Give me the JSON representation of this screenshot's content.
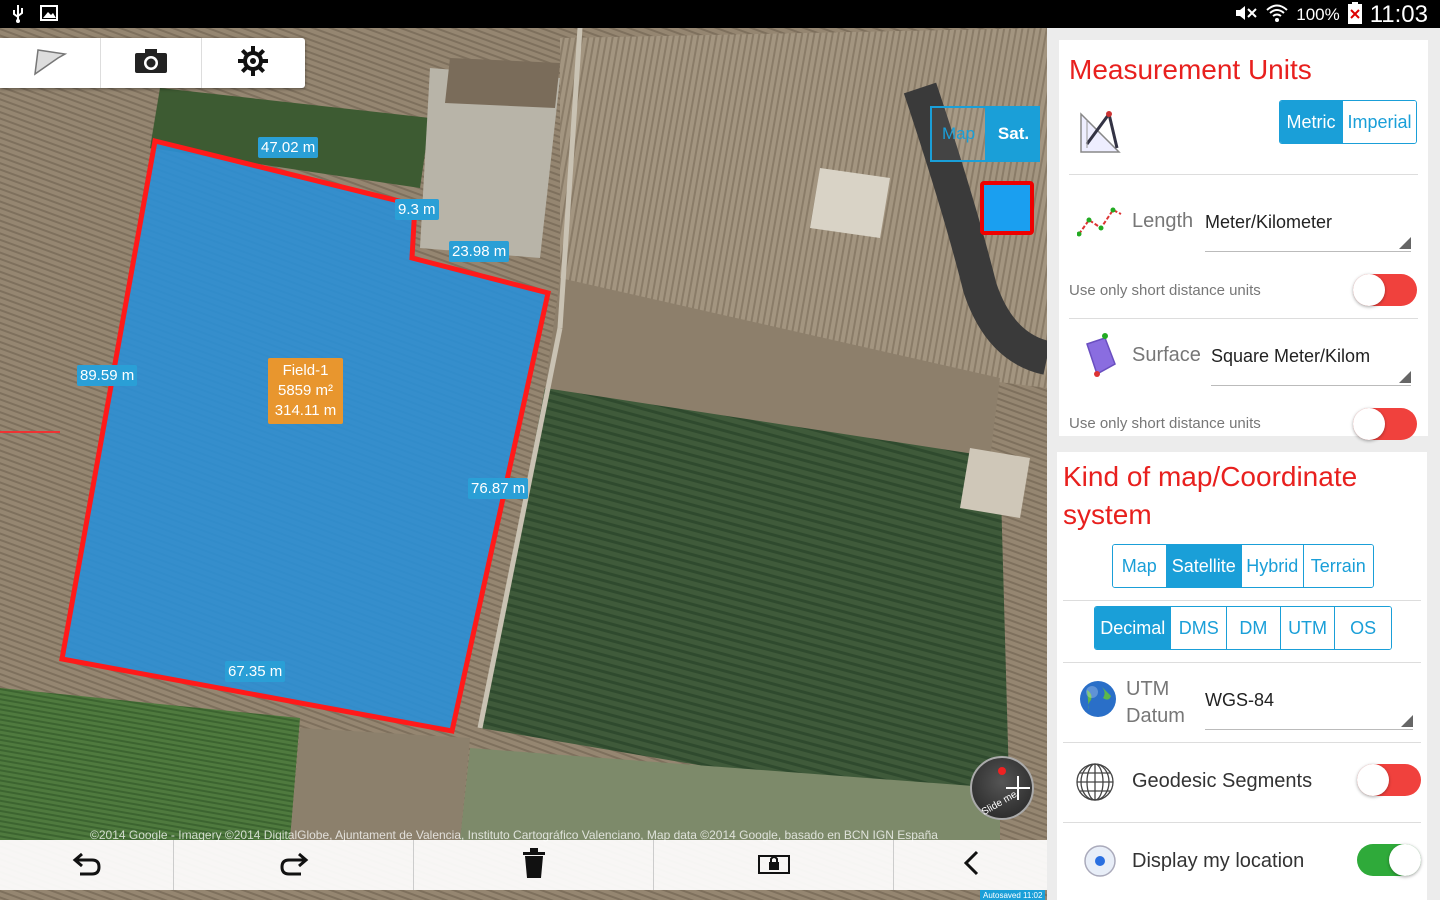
{
  "statusbar": {
    "battery": "100%",
    "time": "11:03"
  },
  "toolbar": {
    "icons": [
      "polygon-icon",
      "camera-icon",
      "gear-icon"
    ]
  },
  "map_toggle": {
    "map_label": "Map",
    "sat_label": "Sat."
  },
  "field": {
    "name": "Field-1",
    "area": "5859 m²",
    "perimeter": "314.11 m",
    "segments": [
      "47.02 m",
      "9.3 m",
      "23.98 m",
      "89.59 m",
      "76.87 m",
      "67.35 m"
    ]
  },
  "copyright": "©2014 Google - Imagery ©2014 DigitalGlobe, Ajuntament de Valencia, Instituto Cartográfico Valenciano, Map data ©2014 Google, basado en BCN IGN España",
  "autosaved": "Autosaved 11:02",
  "compass_label": "Slide me",
  "measurement": {
    "title": "Measurement Units",
    "systems": [
      "Metric",
      "Imperial"
    ],
    "selected_system": "Metric",
    "length_label": "Length",
    "length_value": "Meter/Kilometer",
    "length_short_text": "Use only short distance units",
    "surface_label": "Surface",
    "surface_value": "Square Meter/Kilom",
    "surface_short_text": "Use only short distance units"
  },
  "mapkind": {
    "title_line1": "Kind of map/Coordinate",
    "title_line2": "system",
    "map_types": [
      "Map",
      "Satellite",
      "Hybrid",
      "Terrain"
    ],
    "selected_map_type": "Satellite",
    "coord_formats": [
      "Decimal",
      "DMS",
      "DM",
      "UTM",
      "OS"
    ],
    "selected_coord_format": "Decimal",
    "utm_label": "UTM",
    "datum_label": "Datum",
    "datum_value": "WGS-84",
    "geodesic_label": "Geodesic Segments",
    "location_label": "Display my location"
  },
  "toggles": {
    "length_short": false,
    "surface_short": false,
    "geodesic": false,
    "location": true
  },
  "colors": {
    "accent": "#1a9fd8",
    "title_red": "#e8201e",
    "field_fill": "#2a8fd6",
    "field_stroke": "#ff1a1a",
    "toggle_off": "#f0413d",
    "toggle_on": "#2faa3a"
  }
}
